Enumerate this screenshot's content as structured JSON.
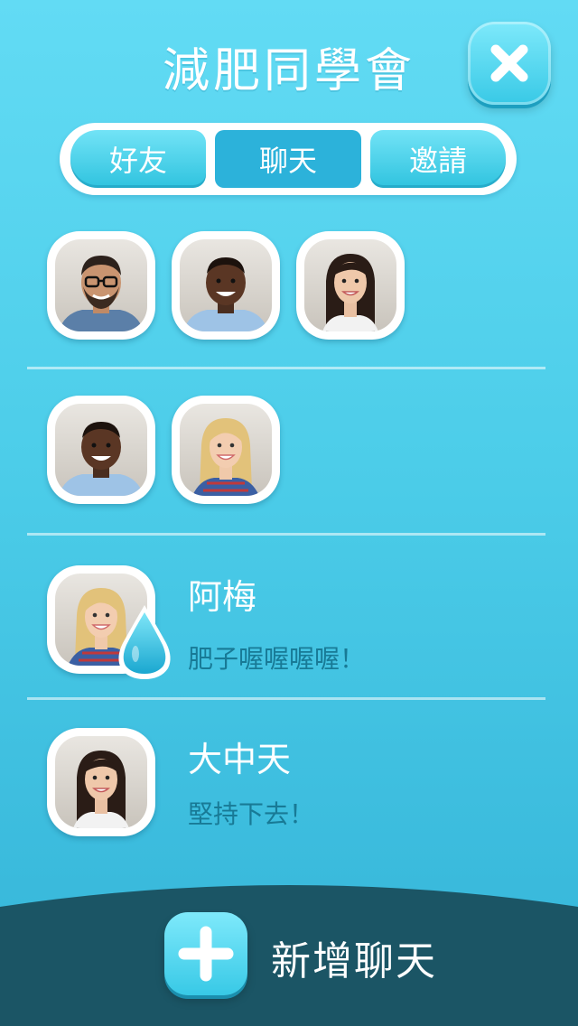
{
  "header": {
    "title": "減肥同學會",
    "close_icon": "close-icon"
  },
  "tabs": [
    {
      "label": "好友",
      "selected": false
    },
    {
      "label": "聊天",
      "selected": true
    },
    {
      "label": "邀請",
      "selected": false
    }
  ],
  "groups": [
    {
      "members": [
        "man-glasses-beard",
        "man-smiling",
        "woman-dark-hair"
      ]
    },
    {
      "members": [
        "man-smiling",
        "woman-blonde"
      ]
    }
  ],
  "chats": [
    {
      "name": "阿梅",
      "message": "肥子喔喔喔喔！",
      "avatar": "woman-blonde",
      "unread_icon": "water-drop-icon"
    },
    {
      "name": "大中天",
      "message": "堅持下去！",
      "avatar": "woman-dark-hair"
    }
  ],
  "footer": {
    "add_label": "新增聊天",
    "add_icon": "plus-icon"
  },
  "colors": {
    "background_top": "#62dbf4",
    "background_bottom": "#34b4d8",
    "footer": "#1b5565",
    "tab_selected": "#2cb2da",
    "message_text": "#187a96"
  }
}
